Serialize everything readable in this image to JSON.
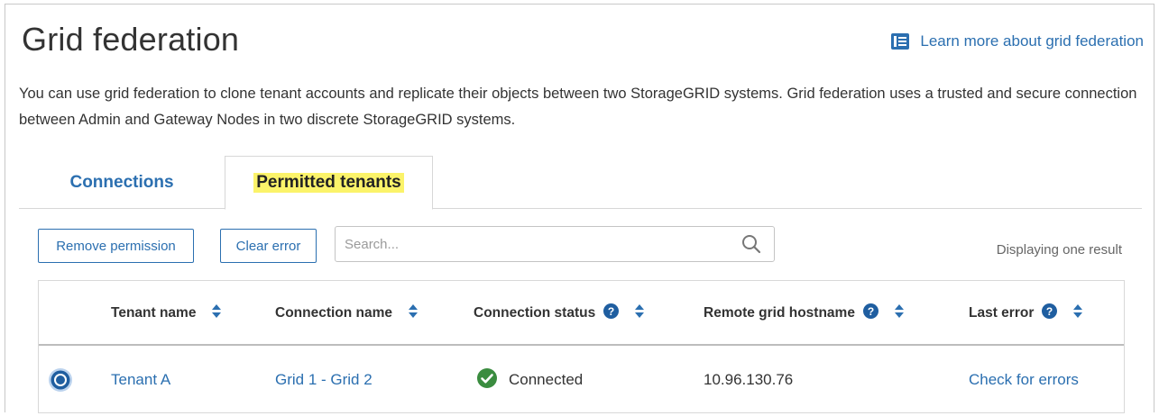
{
  "header": {
    "title": "Grid federation",
    "learn_more": "Learn more about grid federation"
  },
  "intro": {
    "text": "You can use grid federation to clone tenant accounts and replicate their objects between two StorageGRID systems. Grid federation uses a trusted and secure connection between Admin and Gateway Nodes in two discrete StorageGRID systems."
  },
  "tabs": [
    {
      "label": "Connections",
      "active": false
    },
    {
      "label": "Permitted tenants",
      "active": true
    }
  ],
  "toolbar": {
    "remove_label": "Remove permission",
    "clear_label": "Clear error",
    "search_placeholder": "Search...",
    "result_text": "Displaying one result"
  },
  "table": {
    "columns": [
      {
        "label": "Tenant name",
        "help": false
      },
      {
        "label": "Connection name",
        "help": false
      },
      {
        "label": "Connection status",
        "help": true
      },
      {
        "label": "Remote grid hostname",
        "help": true
      },
      {
        "label": "Last error",
        "help": true
      }
    ],
    "rows": [
      {
        "selected": true,
        "tenant": "Tenant A",
        "connection": "Grid 1 - Grid 2",
        "status": "Connected",
        "hostname": "10.96.130.76",
        "last_error": "Check for errors"
      }
    ]
  },
  "colors": {
    "link": "#2b6fb0",
    "highlight": "#fbf36a",
    "success": "#3a8c3f"
  },
  "icons": {
    "learn": "book-icon",
    "search": "search-icon",
    "help": "help-circle-icon",
    "sort": "sort-icon",
    "status": "check-circle-icon"
  }
}
